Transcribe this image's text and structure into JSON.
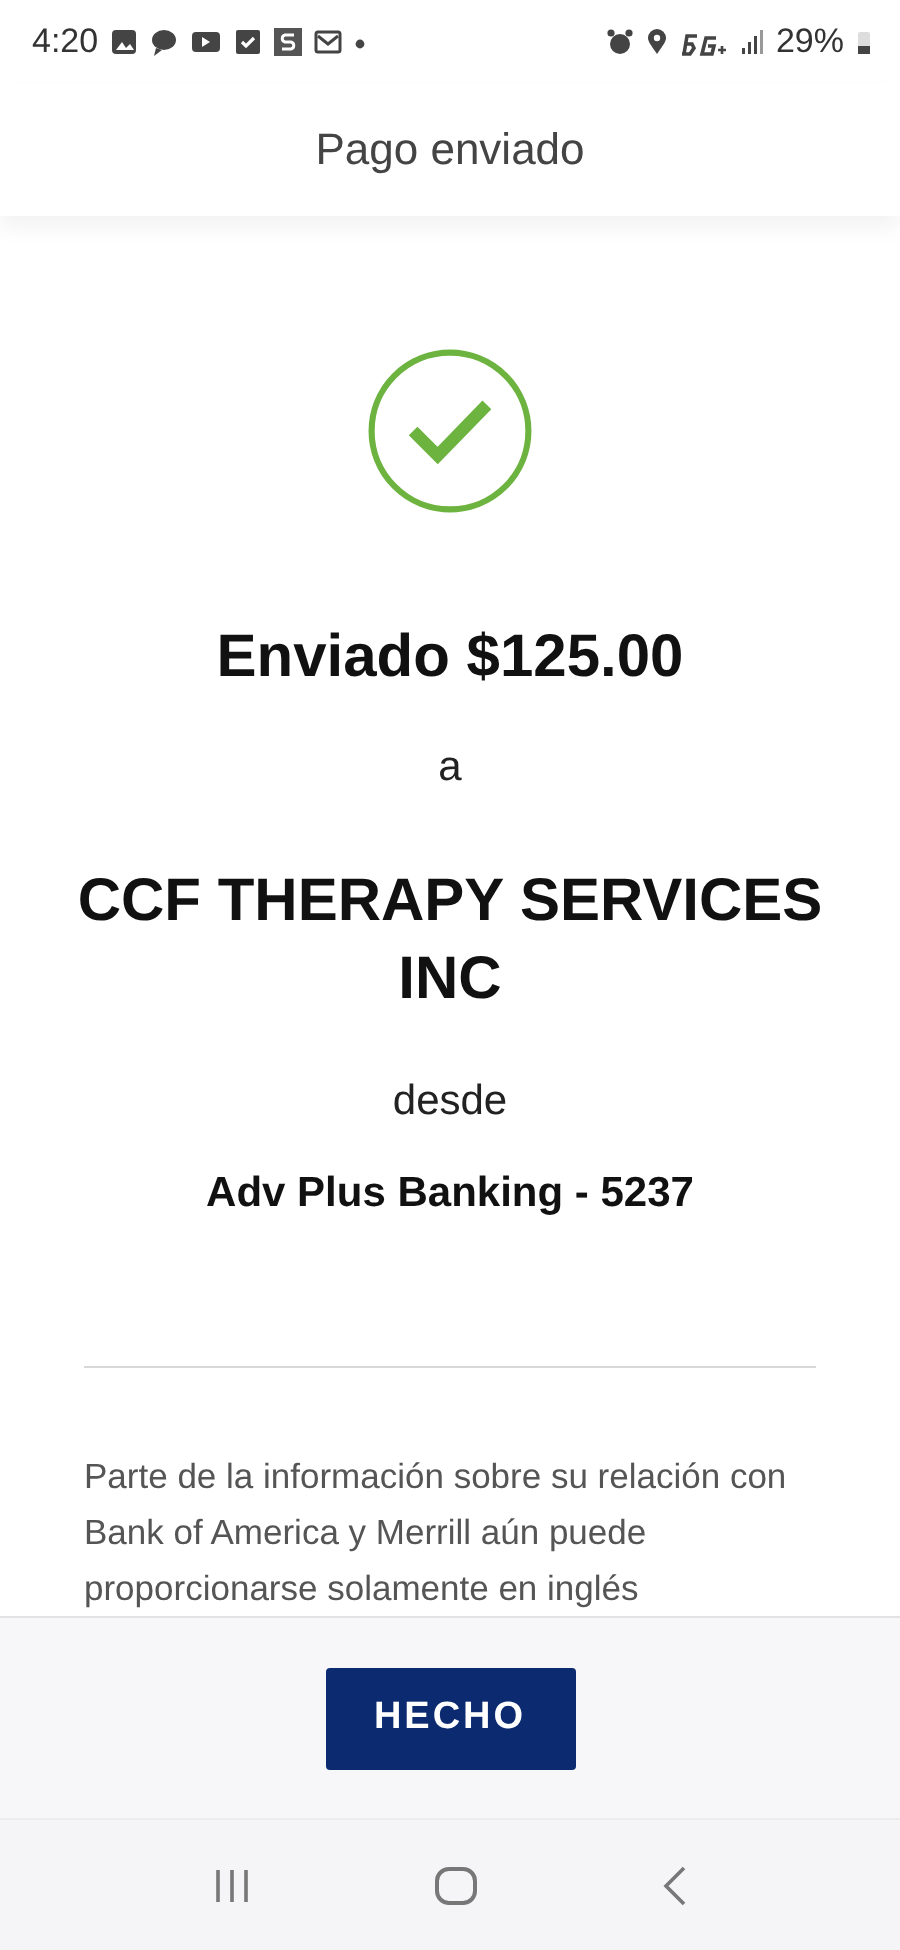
{
  "status_bar": {
    "time": "4:20",
    "battery": "29%"
  },
  "header": {
    "title": "Pago enviado"
  },
  "confirmation": {
    "amount_line": "Enviado $125.00",
    "to_label": "a",
    "recipient": "CCF THERAPY SERVICES INC",
    "from_label": "desde",
    "account": "Adv Plus Banking - 5237"
  },
  "notice": "Parte de la información sobre su relación con Bank of America y Merrill aún puede proporcionarse solamente en inglés",
  "footer": {
    "button": "HECHO"
  }
}
